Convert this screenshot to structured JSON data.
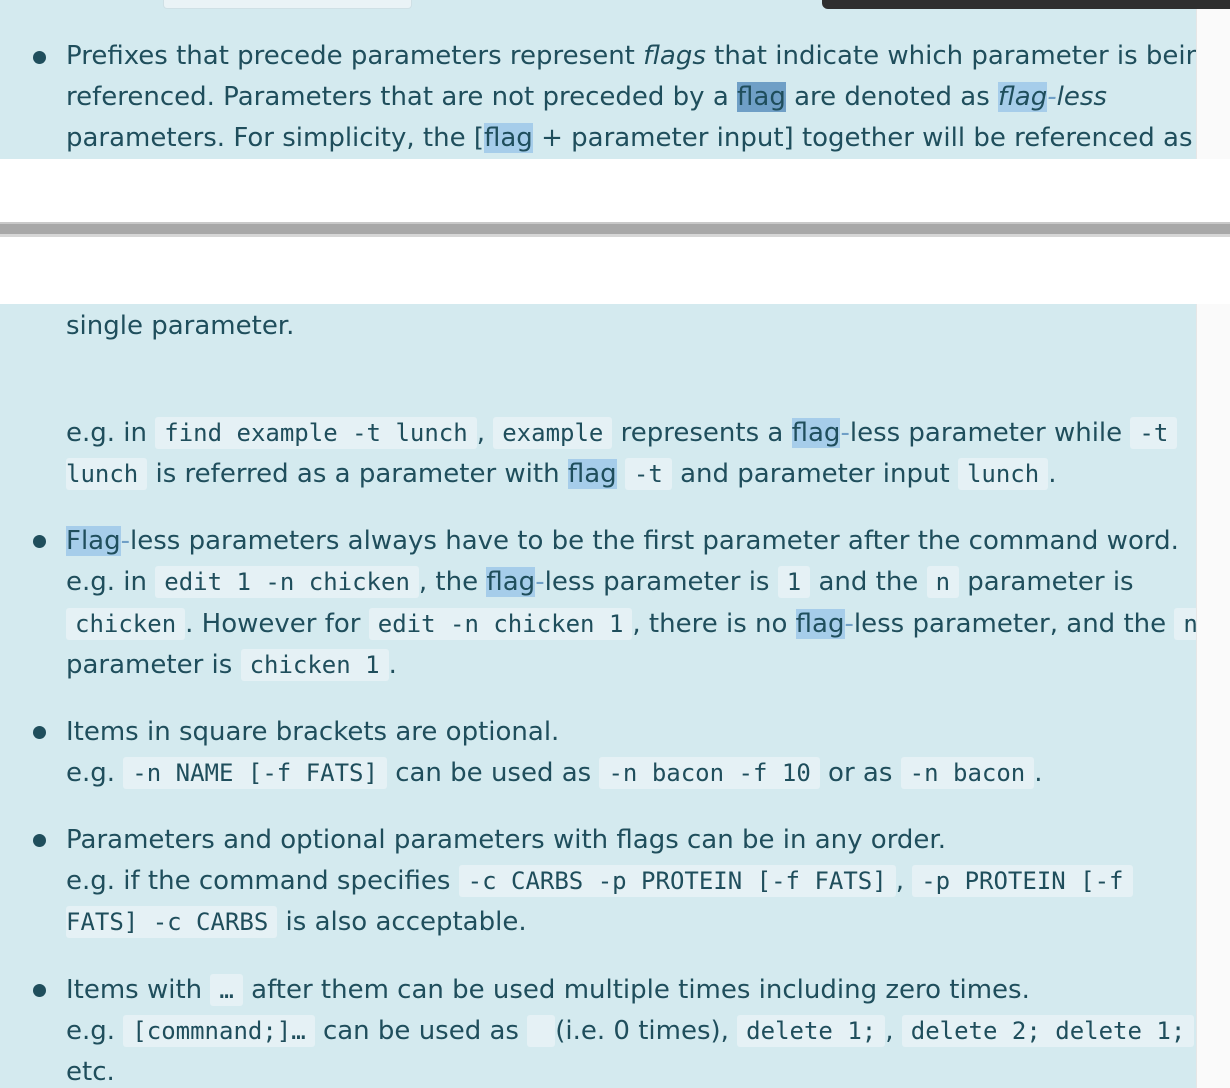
{
  "window": {
    "width": 1230,
    "height": 1088
  },
  "colors": {
    "panel_bg": "#d4eaef",
    "text": "#1f4e5c",
    "highlight": "#a6cdea",
    "highlight_current": "#6f9fc6",
    "code_bg": "#e5f1f5"
  },
  "top": {
    "l1_a": "Prefixes that precede parameters represent ",
    "l1_em": "flags",
    "l1_b": " that indicate which parameter is being",
    "l2_a": "referenced. Parameters that are not preceded by a ",
    "l2_hl": "flag",
    "l2_b": " are denoted as ",
    "l2_em_a": "flag",
    "l2_em_dash": "-",
    "l2_em_b": "less",
    "l3_a": "parameters. For simplicity, the [",
    "l3_hl": "flag",
    "l3_b": " + parameter input] together will be referenced as a"
  },
  "bottom": {
    "cont": "single parameter.",
    "eg1": {
      "a": "e.g. in ",
      "c1": "find example -t lunch",
      "b": ", ",
      "c2": "example",
      "c": " represents a ",
      "hl": "flag",
      "dash": "-",
      "d": "less parameter while ",
      "c3a": "-t",
      "c3b": "lunch",
      "e": " is referred as a parameter with ",
      "hl2": "flag",
      "f": " ",
      "c4": "-t",
      "g": " and parameter input ",
      "c5": "lunch",
      "h": "."
    },
    "b2": {
      "l1_hl": "Flag",
      "l1_dash": "-",
      "l1": "less parameters always have to be the first parameter after the command word.",
      "l2_a": "e.g. in ",
      "l2_c1": "edit 1 -n chicken",
      "l2_b": ", the ",
      "l2_hl": "flag",
      "l2_dash": "-",
      "l2_c": "less parameter is ",
      "l2_c2": "1",
      "l2_d": " and the ",
      "l2_c3": "n",
      "l2_e": " parameter is",
      "l3_c1": "chicken",
      "l3_a": ". However for ",
      "l3_c2": "edit -n chicken 1",
      "l3_b": ", there is no ",
      "l3_hl": "flag",
      "l3_dash": "-",
      "l3_c": "less parameter, and the ",
      "l3_c3": "n",
      "l4_a": "parameter is ",
      "l4_c1": "chicken 1",
      "l4_b": "."
    },
    "b3": {
      "l1": "Items in square brackets are optional.",
      "l2_a": "e.g. ",
      "l2_c1": "-n NAME [-f FATS]",
      "l2_b": " can be used as ",
      "l2_c2": "-n bacon -f 10",
      "l2_c": " or as ",
      "l2_c3": "-n bacon",
      "l2_d": "."
    },
    "b4": {
      "l1": "Parameters and optional parameters with flags can be in any order.",
      "l2_a": "e.g. if the command specifies ",
      "l2_c1": "-c CARBS -p PROTEIN [-f FATS]",
      "l2_b": ", ",
      "l2_c2": "-p PROTEIN [-f",
      "l3_c1": "FATS] -c CARBS",
      "l3_a": " is also acceptable."
    },
    "b5": {
      "l1_a": "Items with ",
      "l1_c1": "…",
      "l1_b": " after them can be used multiple times including zero times.",
      "l2_a": "e.g. ",
      "l2_c1": "[commnand;]…",
      "l2_b": " can be used as ",
      "l2_c2": " ",
      "l2_c": " (i.e. 0 times), ",
      "l2_c3": "delete 1;",
      "l2_d": ", ",
      "l2_c4": "delete 2; delete 1;",
      "l3": "etc."
    }
  }
}
